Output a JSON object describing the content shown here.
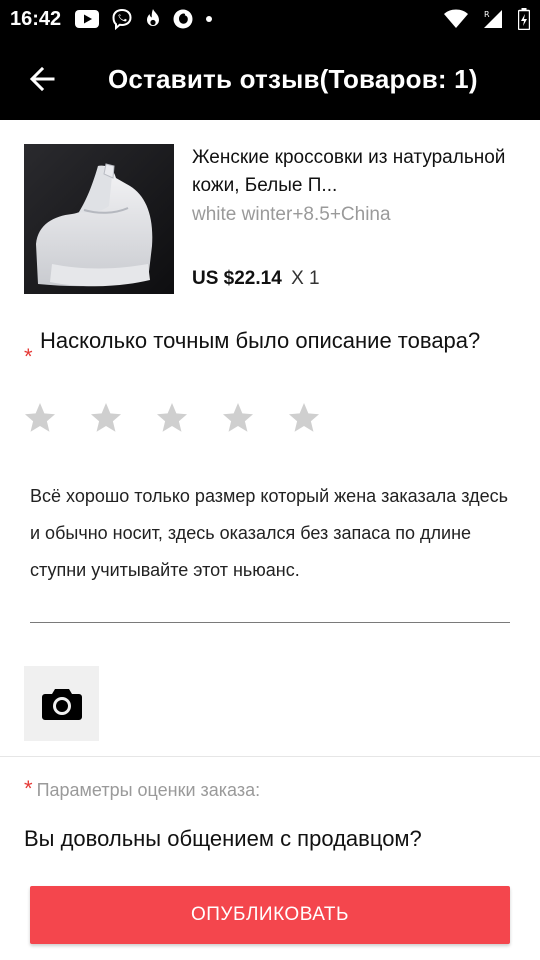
{
  "status_bar": {
    "time": "16:42",
    "left_icons": [
      "youtube-icon",
      "viber-icon",
      "flame-icon",
      "vodafone-icon",
      "dot-icon"
    ],
    "right_icons": [
      "wifi-icon",
      "signal-roaming-icon",
      "battery-icon"
    ]
  },
  "app_bar": {
    "back_icon": "arrow-left-icon",
    "title": "Оставить отзыв(Товаров: 1)"
  },
  "product": {
    "title": "Женские кроссовки из натуральной кожи, Белые П...",
    "variant": "white winter+8.5+China",
    "price": "US $22.14",
    "quantity": "X 1"
  },
  "rating_question": {
    "required_mark": "*",
    "text": "Насколько точным было описание товара?",
    "rating": 0,
    "max_rating": 5
  },
  "review": {
    "text": "Всё хорошо только размер который жена заказала здесь и обычно носит, здесь оказался без запаса по длине ступни учитывайте этот ньюанс."
  },
  "photo_button": {
    "icon": "camera-icon"
  },
  "params": {
    "required_mark": "*",
    "label": "Параметры оценки заказа:"
  },
  "seller_question": "Вы довольны общением с продавцом?",
  "publish_button": {
    "label": "ОПУБЛИКОВАТЬ"
  },
  "colors": {
    "accent": "#f4464d",
    "required": "#e53935",
    "star_empty": "#cfcfcf",
    "muted_text": "#9a9a9a"
  }
}
